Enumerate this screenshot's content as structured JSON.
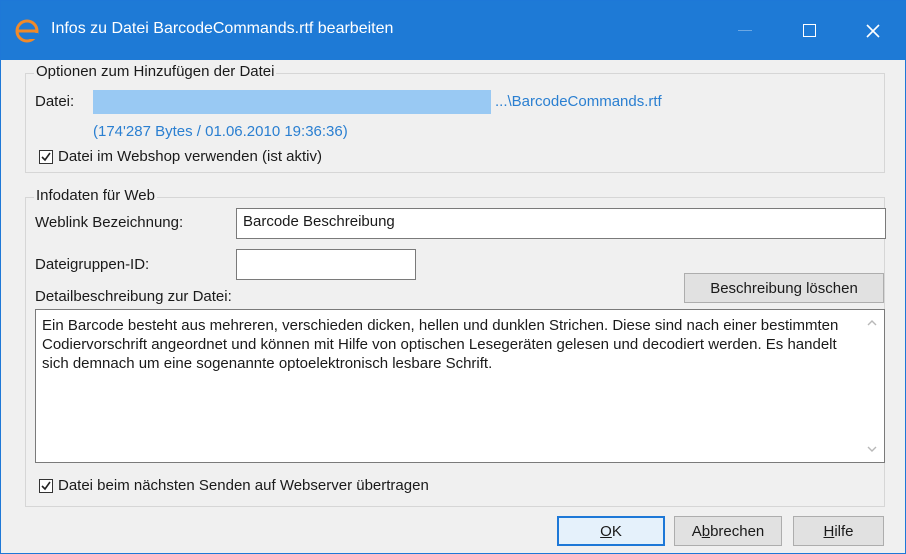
{
  "window": {
    "title": "Infos zu Datei BarcodeCommands.rtf bearbeiten",
    "accent_color": "#1e7ad6"
  },
  "group_options": {
    "title": "Optionen zum Hinzufügen der Datei",
    "file_label": "Datei:",
    "file_path": "...\\BarcodeCommands.rtf",
    "file_info": "(174'287 Bytes / 01.06.2010 19:36:36)",
    "webshop_checkbox_label": "Datei im Webshop verwenden (ist aktiv)",
    "webshop_checked": true
  },
  "group_web": {
    "title": "Infodaten für Web",
    "weblink_label": "Weblink Bezeichnung:",
    "weblink_value": "Barcode Beschreibung",
    "group_id_label": "Dateigruppen-ID:",
    "group_id_value": "",
    "clear_description_button": "Beschreibung löschen",
    "description_label": "Detailbeschreibung zur Datei:",
    "description_text": "Ein Barcode besteht aus mehreren, verschieden dicken, hellen und dunklen Strichen. Diese sind nach einer bestimmten Codiervorschrift angeordnet und können mit Hilfe von optischen Lesegeräten gelesen und decodiert werden. Es handelt sich demnach um eine sogenannte optoelektronisch lesbare Schrift.",
    "transfer_checkbox_label": "Datei beim nächsten Senden auf Webserver übertragen",
    "transfer_checked": true
  },
  "buttons": {
    "ok": {
      "accel": "O",
      "rest": "K"
    },
    "cancel": {
      "pre": "A",
      "accel": "b",
      "rest": "brechen"
    },
    "help": {
      "accel": "H",
      "rest": "ilfe"
    }
  }
}
